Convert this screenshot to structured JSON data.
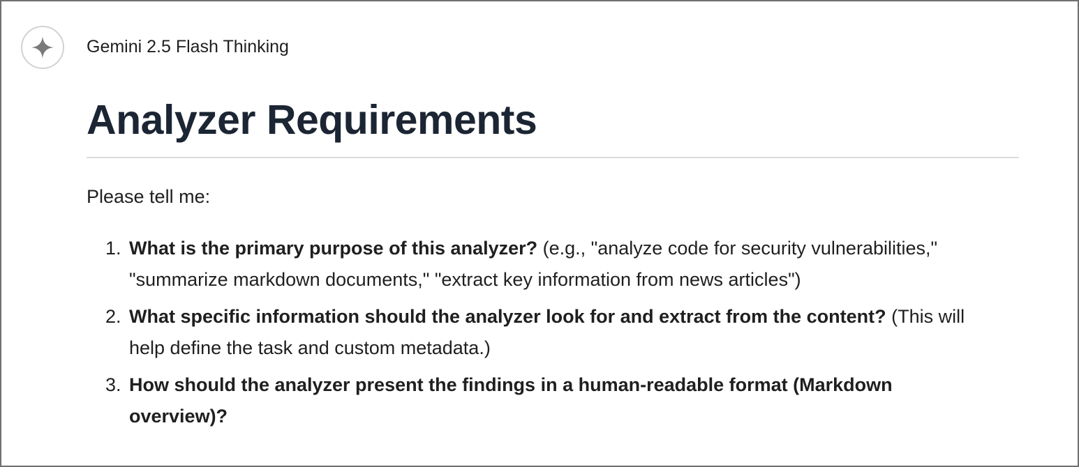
{
  "header": {
    "model_name": "Gemini 2.5 Flash Thinking",
    "avatar_icon": "sparkle-icon"
  },
  "response": {
    "heading": "Analyzer Requirements",
    "intro": "Please tell me:",
    "items": [
      {
        "number": "1.",
        "question": "What is the primary purpose of this analyzer?",
        "detail": "(e.g., \"analyze code for security vulnerabilities,\" \"summarize markdown documents,\" \"extract key information from news articles\")"
      },
      {
        "number": "2.",
        "question": "What specific information should the analyzer look for and extract from the content?",
        "detail": "(This will help define the task and custom metadata.)"
      },
      {
        "number": "3.",
        "question": "How should the analyzer present the findings in a human-readable format (Markdown overview)?",
        "detail": ""
      }
    ]
  },
  "colors": {
    "heading": "#1c2533",
    "text": "#1f1f1f",
    "divider": "#dcdcdc",
    "avatar_border": "#d2d2d2",
    "sparkle": "#7a7a7a"
  }
}
